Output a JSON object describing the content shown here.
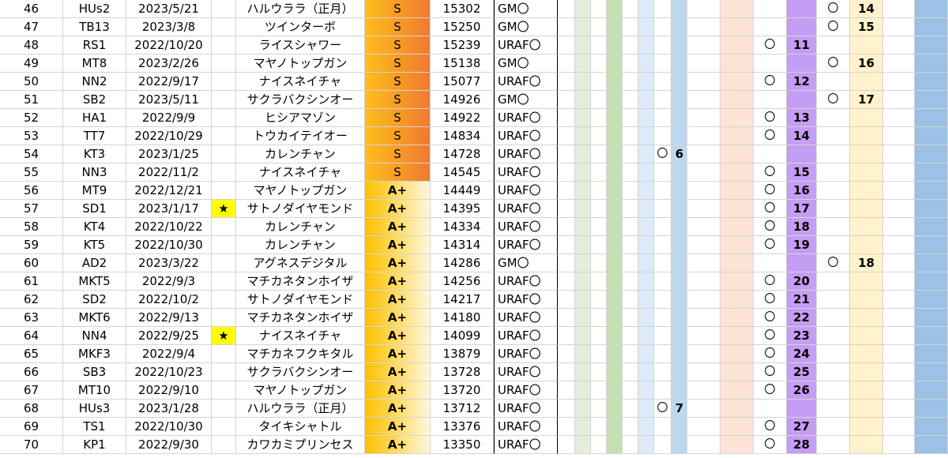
{
  "sheet": {
    "rows": [
      {
        "no": "46",
        "id": "HUs2",
        "date": "2023/5/21",
        "star": "",
        "name": "ハルウララ（正月）",
        "rank": "S",
        "score": "15302",
        "tag": "GM〇",
        "g1": "",
        "g1_num": "",
        "g2": "",
        "g2_num": "",
        "g3": "〇",
        "g3_num": "14"
      },
      {
        "no": "47",
        "id": "TB13",
        "date": "2023/3/8",
        "star": "",
        "name": "ツインターボ",
        "rank": "S",
        "score": "15250",
        "tag": "GM〇",
        "g1": "",
        "g1_num": "",
        "g2": "",
        "g2_num": "",
        "g3": "〇",
        "g3_num": "15"
      },
      {
        "no": "48",
        "id": "RS1",
        "date": "2022/10/20",
        "star": "",
        "name": "ライスシャワー",
        "rank": "S",
        "score": "15239",
        "tag": "URAF〇",
        "g1": "",
        "g1_num": "",
        "g2": "〇",
        "g2_num": "11",
        "g3": "",
        "g3_num": ""
      },
      {
        "no": "49",
        "id": "MT8",
        "date": "2023/2/26",
        "star": "",
        "name": "マヤノトップガン",
        "rank": "S",
        "score": "15138",
        "tag": "GM〇",
        "g1": "",
        "g1_num": "",
        "g2": "",
        "g2_num": "",
        "g3": "〇",
        "g3_num": "16"
      },
      {
        "no": "50",
        "id": "NN2",
        "date": "2022/9/17",
        "star": "",
        "name": "ナイスネイチャ",
        "rank": "S",
        "score": "15077",
        "tag": "URAF〇",
        "g1": "",
        "g1_num": "",
        "g2": "〇",
        "g2_num": "12",
        "g3": "",
        "g3_num": ""
      },
      {
        "no": "51",
        "id": "SB2",
        "date": "2023/5/11",
        "star": "",
        "name": "サクラバクシンオー",
        "rank": "S",
        "score": "14926",
        "tag": "GM〇",
        "g1": "",
        "g1_num": "",
        "g2": "",
        "g2_num": "",
        "g3": "〇",
        "g3_num": "17"
      },
      {
        "no": "52",
        "id": "HA1",
        "date": "2022/9/9",
        "star": "",
        "name": "ヒシアマゾン",
        "rank": "S",
        "score": "14922",
        "tag": "URAF〇",
        "g1": "",
        "g1_num": "",
        "g2": "〇",
        "g2_num": "13",
        "g3": "",
        "g3_num": ""
      },
      {
        "no": "53",
        "id": "TT7",
        "date": "2022/10/29",
        "star": "",
        "name": "トウカイテイオー",
        "rank": "S",
        "score": "14834",
        "tag": "URAF〇",
        "g1": "",
        "g1_num": "",
        "g2": "〇",
        "g2_num": "14",
        "g3": "",
        "g3_num": ""
      },
      {
        "no": "54",
        "id": "KT3",
        "date": "2023/1/25",
        "star": "",
        "name": "カレンチャン",
        "rank": "S",
        "score": "14728",
        "tag": "URAF〇",
        "g1": "〇",
        "g1_num": "6",
        "g2": "",
        "g2_num": "",
        "g3": "",
        "g3_num": ""
      },
      {
        "no": "55",
        "id": "NN3",
        "date": "2022/11/2",
        "star": "",
        "name": "ナイスネイチャ",
        "rank": "S",
        "score": "14545",
        "tag": "URAF〇",
        "g1": "",
        "g1_num": "",
        "g2": "〇",
        "g2_num": "15",
        "g3": "",
        "g3_num": ""
      },
      {
        "no": "56",
        "id": "MT9",
        "date": "2022/12/21",
        "star": "",
        "name": "マヤノトップガン",
        "rank": "A+",
        "score": "14449",
        "tag": "URAF〇",
        "g1": "",
        "g1_num": "",
        "g2": "〇",
        "g2_num": "16",
        "g3": "",
        "g3_num": ""
      },
      {
        "no": "57",
        "id": "SD1",
        "date": "2023/1/17",
        "star": "★",
        "name": "サトノダイヤモンド",
        "rank": "A+",
        "score": "14395",
        "tag": "URAF〇",
        "g1": "",
        "g1_num": "",
        "g2": "〇",
        "g2_num": "17",
        "g3": "",
        "g3_num": ""
      },
      {
        "no": "58",
        "id": "KT4",
        "date": "2022/10/22",
        "star": "",
        "name": "カレンチャン",
        "rank": "A+",
        "score": "14334",
        "tag": "URAF〇",
        "g1": "",
        "g1_num": "",
        "g2": "〇",
        "g2_num": "18",
        "g3": "",
        "g3_num": ""
      },
      {
        "no": "59",
        "id": "KT5",
        "date": "2022/10/30",
        "star": "",
        "name": "カレンチャン",
        "rank": "A+",
        "score": "14314",
        "tag": "URAF〇",
        "g1": "",
        "g1_num": "",
        "g2": "〇",
        "g2_num": "19",
        "g3": "",
        "g3_num": ""
      },
      {
        "no": "60",
        "id": "AD2",
        "date": "2023/3/22",
        "star": "",
        "name": "アグネスデジタル",
        "rank": "A+",
        "score": "14286",
        "tag": "GM〇",
        "g1": "",
        "g1_num": "",
        "g2": "",
        "g2_num": "",
        "g3": "〇",
        "g3_num": "18"
      },
      {
        "no": "61",
        "id": "MKT5",
        "date": "2022/9/3",
        "star": "",
        "name": "マチカネタンホイザ",
        "rank": "A+",
        "score": "14256",
        "tag": "URAF〇",
        "g1": "",
        "g1_num": "",
        "g2": "〇",
        "g2_num": "20",
        "g3": "",
        "g3_num": ""
      },
      {
        "no": "62",
        "id": "SD2",
        "date": "2022/10/2",
        "star": "",
        "name": "サトノダイヤモンド",
        "rank": "A+",
        "score": "14217",
        "tag": "URAF〇",
        "g1": "",
        "g1_num": "",
        "g2": "〇",
        "g2_num": "21",
        "g3": "",
        "g3_num": ""
      },
      {
        "no": "63",
        "id": "MKT6",
        "date": "2022/9/13",
        "star": "",
        "name": "マチカネタンホイザ",
        "rank": "A+",
        "score": "14180",
        "tag": "URAF〇",
        "g1": "",
        "g1_num": "",
        "g2": "〇",
        "g2_num": "22",
        "g3": "",
        "g3_num": ""
      },
      {
        "no": "64",
        "id": "NN4",
        "date": "2022/9/25",
        "star": "★",
        "name": "ナイスネイチャ",
        "rank": "A+",
        "score": "14099",
        "tag": "URAF〇",
        "g1": "",
        "g1_num": "",
        "g2": "〇",
        "g2_num": "23",
        "g3": "",
        "g3_num": ""
      },
      {
        "no": "65",
        "id": "MKF3",
        "date": "2022/9/4",
        "star": "",
        "name": "マチカネフクキタル",
        "rank": "A+",
        "score": "13879",
        "tag": "URAF〇",
        "g1": "",
        "g1_num": "",
        "g2": "〇",
        "g2_num": "24",
        "g3": "",
        "g3_num": ""
      },
      {
        "no": "66",
        "id": "SB3",
        "date": "2022/10/23",
        "star": "",
        "name": "サクラバクシンオー",
        "rank": "A+",
        "score": "13728",
        "tag": "URAF〇",
        "g1": "",
        "g1_num": "",
        "g2": "〇",
        "g2_num": "25",
        "g3": "",
        "g3_num": ""
      },
      {
        "no": "67",
        "id": "MT10",
        "date": "2022/9/10",
        "star": "",
        "name": "マヤノトップガン",
        "rank": "A+",
        "score": "13720",
        "tag": "URAF〇",
        "g1": "",
        "g1_num": "",
        "g2": "〇",
        "g2_num": "26",
        "g3": "",
        "g3_num": ""
      },
      {
        "no": "68",
        "id": "HUs3",
        "date": "2023/1/28",
        "star": "",
        "name": "ハルウララ（正月）",
        "rank": "A+",
        "score": "13712",
        "tag": "URAF〇",
        "g1": "〇",
        "g1_num": "7",
        "g2": "",
        "g2_num": "",
        "g3": "",
        "g3_num": ""
      },
      {
        "no": "69",
        "id": "TS1",
        "date": "2022/10/30",
        "star": "",
        "name": "タイキシャトル",
        "rank": "A+",
        "score": "13376",
        "tag": "URAF〇",
        "g1": "",
        "g1_num": "",
        "g2": "〇",
        "g2_num": "27",
        "g3": "",
        "g3_num": ""
      },
      {
        "no": "70",
        "id": "KP1",
        "date": "2022/9/30",
        "star": "",
        "name": "カワカミプリンセス",
        "rank": "A+",
        "score": "13350",
        "tag": "URAF〇",
        "g1": "",
        "g1_num": "",
        "g2": "〇",
        "g2_num": "28",
        "g3": "",
        "g3_num": ""
      }
    ]
  },
  "colors": {
    "rank_s": "#ee7a30",
    "rank_a_plus": "#ffc000",
    "star_highlight": "#ffff00",
    "band_green_light": "#e3efda",
    "band_green": "#c6e0b4",
    "band_blue_light": "#ddebf7",
    "band_blue": "#bdd7ee",
    "band_peach": "#fce4d6",
    "band_purple": "#c49df4",
    "band_cream": "#fff2cc",
    "band_blue_dark": "#9bc2e6"
  }
}
